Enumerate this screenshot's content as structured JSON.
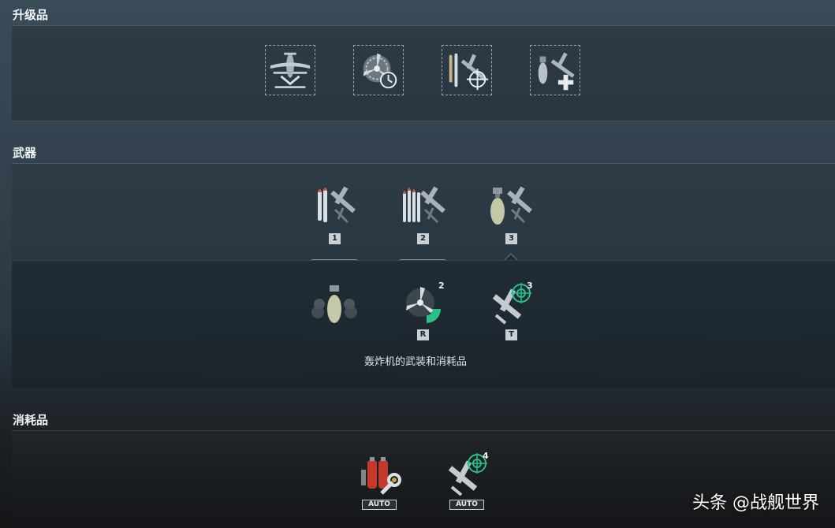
{
  "sections": {
    "upgrades": {
      "title": "升级品"
    },
    "weapons": {
      "title": "武器"
    },
    "consumables": {
      "title": "消耗品"
    }
  },
  "upgrades": [
    {
      "icon": "aircraft-landing-icon"
    },
    {
      "icon": "engine-cooldown-icon"
    },
    {
      "icon": "torpedo-aiming-icon"
    },
    {
      "icon": "bomber-hp-icon"
    }
  ],
  "weapons": [
    {
      "icon": "rocket-attack-aircraft-icon",
      "badge": "1"
    },
    {
      "icon": "torpedo-bomber-icon",
      "badge": "2"
    },
    {
      "icon": "dive-bomber-icon",
      "badge": "3"
    }
  ],
  "bomber_loadout": {
    "caption": "轰炸机的武装和消耗品",
    "items": [
      {
        "icon": "smoke-bomb-icon"
      },
      {
        "icon": "engine-boost-icon",
        "count": "2",
        "hotkey": "R"
      },
      {
        "icon": "fighter-patrol-icon",
        "count": "3",
        "hotkey": "T"
      }
    ]
  },
  "consumables": [
    {
      "icon": "damage-control-party-icon",
      "auto": "AUTO"
    },
    {
      "icon": "catapult-fighter-icon",
      "count": "4",
      "auto": "AUTO"
    }
  ],
  "watermark": "头条 @战舰世界",
  "colors": {
    "accent_green": "#29c08a",
    "badge_bg": "#c9cfd3",
    "repair_red": "#c43a2a"
  }
}
